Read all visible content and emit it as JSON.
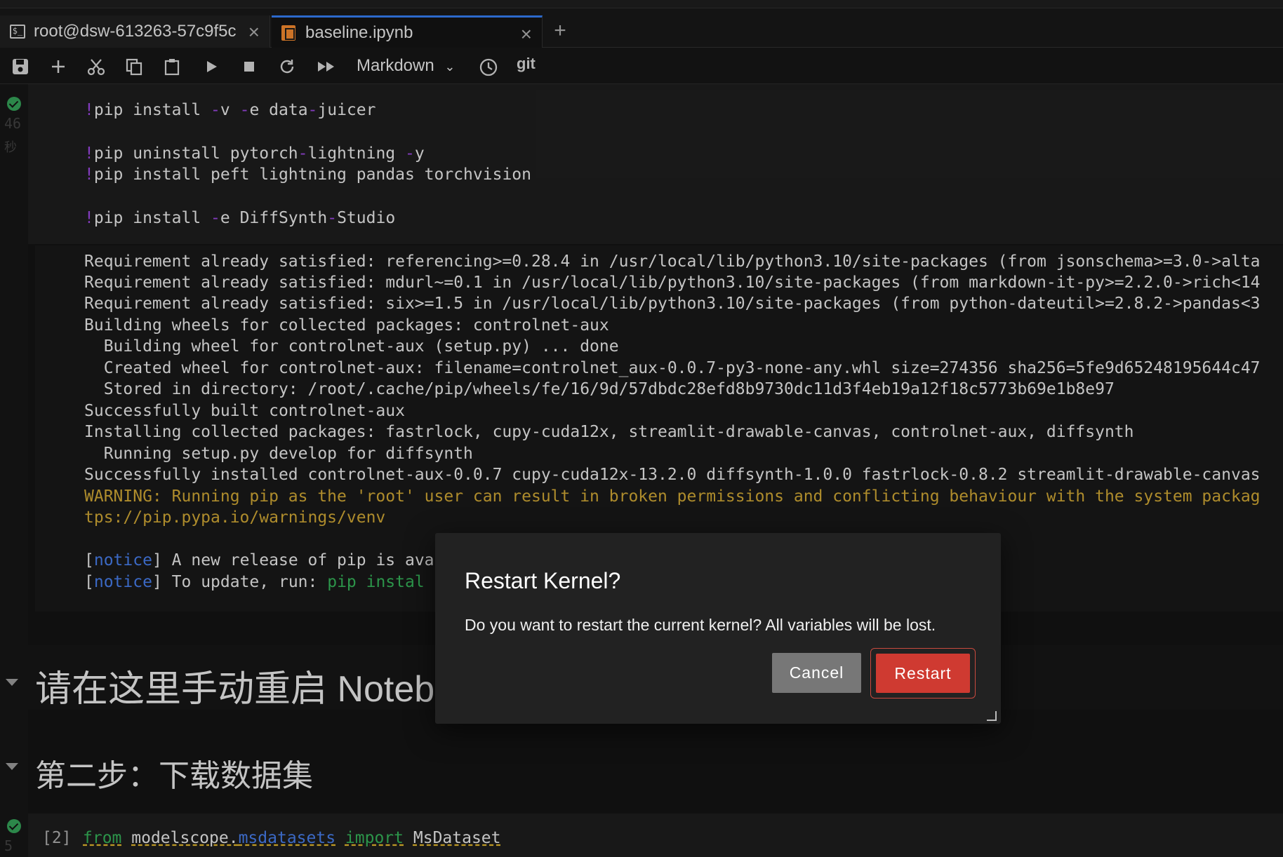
{
  "tabs": [
    {
      "label": "root@dsw-613263-57c9f5c",
      "icon": "terminal-icon"
    },
    {
      "label": "baseline.ipynb",
      "icon": "notebook-icon"
    }
  ],
  "toolbar": {
    "cell_type": "Markdown",
    "git_label": "git"
  },
  "gutter": {
    "cell1_time": "46",
    "cell1_unit": "秒",
    "cell2_time": "5"
  },
  "code_cell": {
    "lines": [
      {
        "bang": "!",
        "a": "pip install ",
        "d1": "-",
        "b": "v ",
        "d2": "-",
        "c": "e data",
        "d3": "-",
        "e": "juicer"
      },
      {
        "bang": "!",
        "a": "pip uninstall pytorch",
        "d1": "-",
        "b": "lightning ",
        "d2": "-",
        "c": "y"
      },
      {
        "bang": "!",
        "a": "pip install peft lightning pandas torchvision"
      },
      {
        "bang": "!",
        "a": "pip install ",
        "d1": "-",
        "b": "e DiffSynth",
        "d2": "-",
        "c": "Studio"
      }
    ]
  },
  "output": {
    "lines": [
      "Requirement already satisfied: referencing>=0.28.4 in /usr/local/lib/python3.10/site-packages (from jsonschema>=3.0->alta",
      "Requirement already satisfied: mdurl~=0.1 in /usr/local/lib/python3.10/site-packages (from markdown-it-py>=2.2.0->rich<14",
      "Requirement already satisfied: six>=1.5 in /usr/local/lib/python3.10/site-packages (from python-dateutil>=2.8.2->pandas<3",
      "Building wheels for collected packages: controlnet-aux",
      "  Building wheel for controlnet-aux (setup.py) ... done",
      "  Created wheel for controlnet-aux: filename=controlnet_aux-0.0.7-py3-none-any.whl size=274356 sha256=5fe9d65248195644c47",
      "  Stored in directory: /root/.cache/pip/wheels/fe/16/9d/57dbdc28efd8b9730dc11d3f4eb19a12f18c5773b69e1b8e97",
      "Successfully built controlnet-aux",
      "Installing collected packages: fastrlock, cupy-cuda12x, streamlit-drawable-canvas, controlnet-aux, diffsynth",
      "  Running setup.py develop for diffsynth",
      "Successfully installed controlnet-aux-0.0.7 cupy-cuda12x-13.2.0 diffsynth-1.0.0 fastrlock-0.8.2 streamlit-drawable-canvas"
    ],
    "warning_lines": [
      "WARNING: Running pip as the 'root' user can result in broken permissions and conflicting behaviour with the system packag",
      "tps://pip.pypa.io/warnings/venv"
    ],
    "notice1": {
      "open": "[",
      "word": "notice",
      "close": "]",
      "text": " A new release of pip is ava"
    },
    "notice2": {
      "open": "[",
      "word": "notice",
      "close": "]",
      "text": " To update, run: ",
      "cmd": "pip instal"
    }
  },
  "markdown": {
    "heading1": "请在这里手动重启 Noteb",
    "heading2": "第二步：下载数据集"
  },
  "code_cell2": {
    "prompt": "[2]",
    "kw_from": "from",
    "module_a": "modelscope.",
    "module_b": "msdatasets",
    "kw_import": "import",
    "name": "MsDataset"
  },
  "dialog": {
    "title": "Restart Kernel?",
    "body": "Do you want to restart the current kernel? All variables will be lost.",
    "cancel_label": "Cancel",
    "restart_label": "Restart"
  },
  "colors": {
    "restart_button": "#cf3a31",
    "cancel_button": "#777777",
    "active_tab_accent": "#2f6fd6",
    "warning_text": "#b8942f",
    "success_check": "#2f8f4e"
  }
}
